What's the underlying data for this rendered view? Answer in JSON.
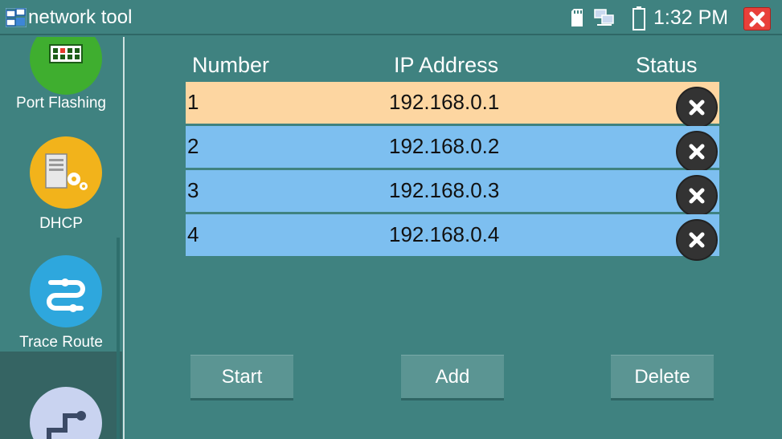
{
  "app": {
    "title": "network tool"
  },
  "status_bar": {
    "time": "1:32 PM",
    "icons": [
      "sd-card-icon",
      "network-icon",
      "battery-icon",
      "close-icon"
    ]
  },
  "sidebar": {
    "items": [
      {
        "label": "Port Flashing",
        "icon": "port-flashing-icon",
        "color": "#3fae2f"
      },
      {
        "label": "DHCP",
        "icon": "dhcp-server-icon",
        "color": "#f2b31b"
      },
      {
        "label": "Trace Route",
        "icon": "trace-route-icon",
        "color": "#2ea7dd"
      },
      {
        "label": "",
        "icon": "route-path-icon",
        "color": "#c9d3f0"
      }
    ]
  },
  "table": {
    "headers": {
      "number": "Number",
      "ip": "IP Address",
      "status": "Status"
    },
    "rows": [
      {
        "number": "1",
        "ip": "192.168.0.1",
        "color": "#fdd6a1"
      },
      {
        "number": "2",
        "ip": "192.168.0.2",
        "color": "#7dbff0"
      },
      {
        "number": "3",
        "ip": "192.168.0.3",
        "color": "#7dbff0"
      },
      {
        "number": "4",
        "ip": "192.168.0.4",
        "color": "#7dbff0"
      }
    ]
  },
  "buttons": {
    "start": "Start",
    "add": "Add",
    "delete": "Delete"
  }
}
